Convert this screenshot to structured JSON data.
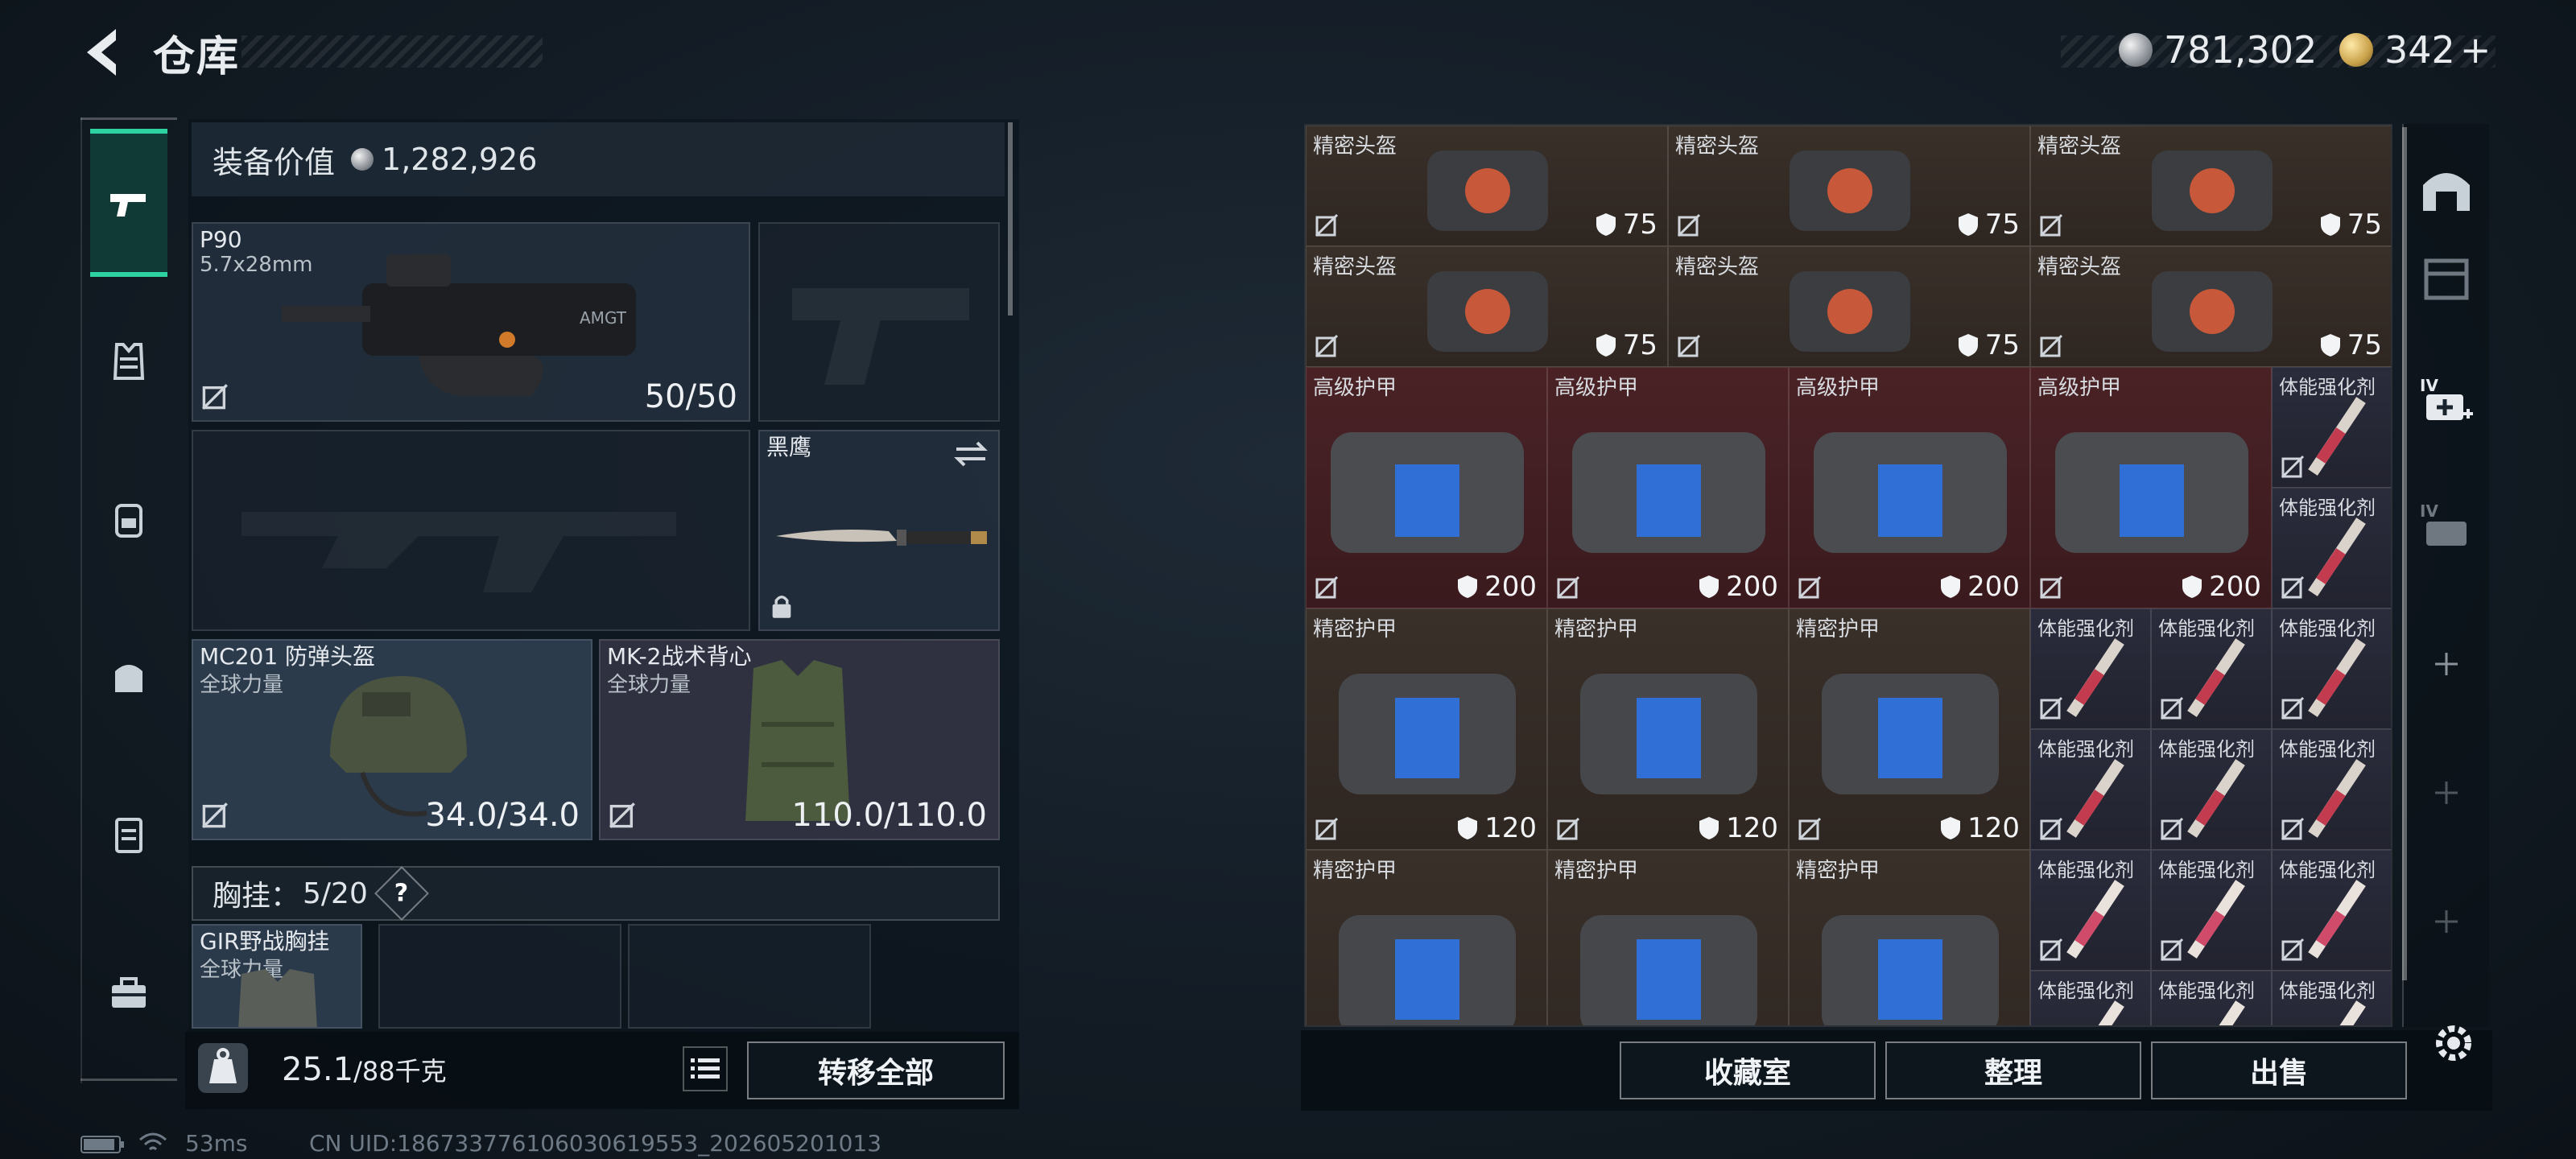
{
  "header": {
    "title": "仓库",
    "silver": "781,302",
    "gold": "342",
    "gold_plus": "+"
  },
  "rail": {
    "items": [
      "pistol-icon",
      "armor-vest-icon",
      "backpack-icon",
      "bag-icon",
      "clipboard-icon",
      "toolbox-icon"
    ],
    "active_index": 0
  },
  "equipment": {
    "value_label": "装备价值",
    "value": "1,282,926",
    "primary": {
      "name": "P90",
      "caliber": "5.7x28mm",
      "ammo": "50/50"
    },
    "melee": {
      "name": "黑鹰"
    },
    "helmet": {
      "name": "MC201 防弹头盔",
      "maker": "全球力量",
      "durability": "34.0/34.0"
    },
    "vest": {
      "name": "MK-2战术背心",
      "maker": "全球力量",
      "durability": "110.0/110.0"
    },
    "chest_rig": {
      "label": "胸挂：",
      "used": "5",
      "capacity": "/20",
      "help": "?"
    },
    "rig_item": {
      "name": "GIR野战胸挂",
      "maker": "全球力量"
    },
    "weight": {
      "current": "25.1",
      "max": "/88千克"
    },
    "transfer_all": "转移全部"
  },
  "storage": {
    "helmet_name": "精密头盔",
    "helmet_value": "75",
    "armor_hi_name": "高级护甲",
    "armor_hi_value": "200",
    "armor_name": "精密护甲",
    "armor_value": "120",
    "stim_name": "体能强化剂",
    "buttons": {
      "collection": "收藏室",
      "organize": "整理",
      "sell": "出售"
    }
  },
  "status_bar": {
    "ping": "53ms",
    "uid": "CN UID:186733776106030619553_202605201013"
  },
  "colors": {
    "accent": "#2fd3a2",
    "helmet_bg": "#3a302a",
    "armor_hi_bg": "#4a2226",
    "stim_bg": "#2a2c3c"
  }
}
